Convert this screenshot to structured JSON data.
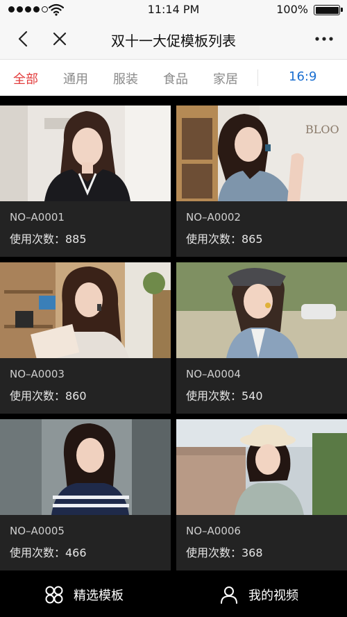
{
  "status_bar": {
    "time": "11:14 PM",
    "battery": "100%"
  },
  "nav": {
    "title": "双十一大促模板列表"
  },
  "tabs": {
    "items": [
      "全部",
      "通用",
      "服装",
      "食品",
      "家居"
    ],
    "active_index": 0,
    "ratio": "16:9"
  },
  "templates": [
    {
      "code": "NO–A0001",
      "uses": "使用次数：885"
    },
    {
      "code": "NO–A0002",
      "uses": "使用次数：865"
    },
    {
      "code": "NO–A0003",
      "uses": "使用次数：860"
    },
    {
      "code": "NO–A0004",
      "uses": "使用次数：540"
    },
    {
      "code": "NO–A0005",
      "uses": "使用次数：466"
    },
    {
      "code": "NO–A0006",
      "uses": "使用次数：368"
    }
  ],
  "bottom_nav": {
    "featured_label": "精选模板",
    "my_videos_label": "我的视频"
  },
  "colors": {
    "accent_red": "#e23c3c",
    "ratio_blue": "#1a6fd1",
    "card_bg": "#232323"
  },
  "icons": [
    "wifi-icon",
    "battery-icon",
    "back-icon",
    "close-icon",
    "more-icon",
    "grid-icon",
    "user-icon"
  ]
}
